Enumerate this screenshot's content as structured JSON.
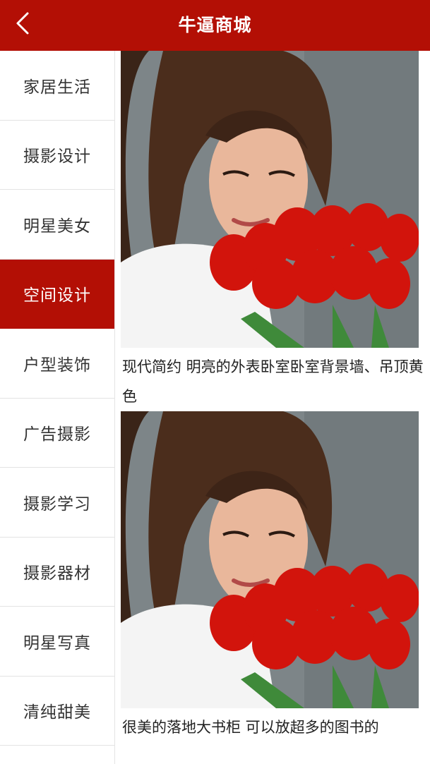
{
  "header": {
    "title": "牛逼商城",
    "back_icon": "chevron-left-icon"
  },
  "sidebar": {
    "items": [
      {
        "label": "家居生活",
        "active": false
      },
      {
        "label": "摄影设计",
        "active": false
      },
      {
        "label": "明星美女",
        "active": false
      },
      {
        "label": "空间设计",
        "active": true
      },
      {
        "label": "户型装饰",
        "active": false
      },
      {
        "label": "广告摄影",
        "active": false
      },
      {
        "label": "摄影学习",
        "active": false
      },
      {
        "label": "摄影器材",
        "active": false
      },
      {
        "label": "明星写真",
        "active": false
      },
      {
        "label": "清纯甜美",
        "active": false
      }
    ]
  },
  "main": {
    "cards": [
      {
        "caption": "现代简约 明亮的外表卧室卧室背景墙、吊顶黄色"
      },
      {
        "caption": "很美的落地大书柜 可以放超多的图书的"
      }
    ]
  },
  "colors": {
    "brand": "#b30f05",
    "divider": "#e3e3e3",
    "text": "#333333"
  }
}
